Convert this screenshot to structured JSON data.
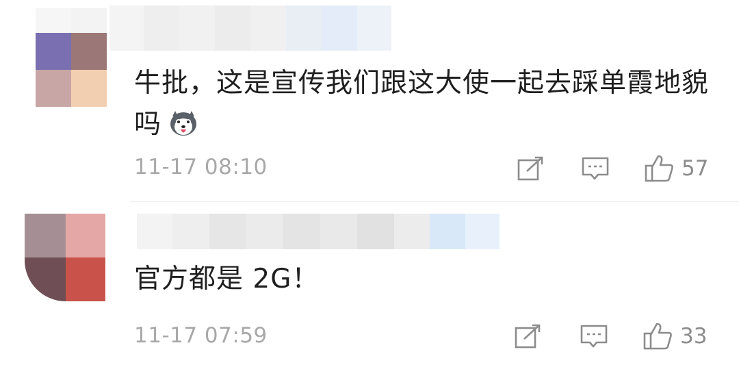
{
  "comments": [
    {
      "text": "牛批，这是宣传我们跟这大使一起去踩单霞地貌吗",
      "emoji": "husky-emoji",
      "time": "11-17 08:10",
      "likes": "57",
      "avatar_colors": [
        "#ffffff",
        "#ffffff",
        "#7a6fb0",
        "#9b7777",
        "#c9a6a6",
        "#f2cfb1"
      ]
    },
    {
      "text": "官方都是 2G！",
      "time": "11-17 07:59",
      "likes": "33",
      "avatar_colors": [
        "#a58f95",
        "#e4a7a5",
        "#6f4f55",
        "#c9524a"
      ]
    }
  ],
  "icons": {
    "share": "share-edit-icon",
    "reply": "comment-bubble-icon",
    "like": "thumbs-up-icon"
  },
  "colors": {
    "text": "#1f1f1f",
    "meta": "#a8a8a8",
    "icon": "#8c8c8c"
  }
}
